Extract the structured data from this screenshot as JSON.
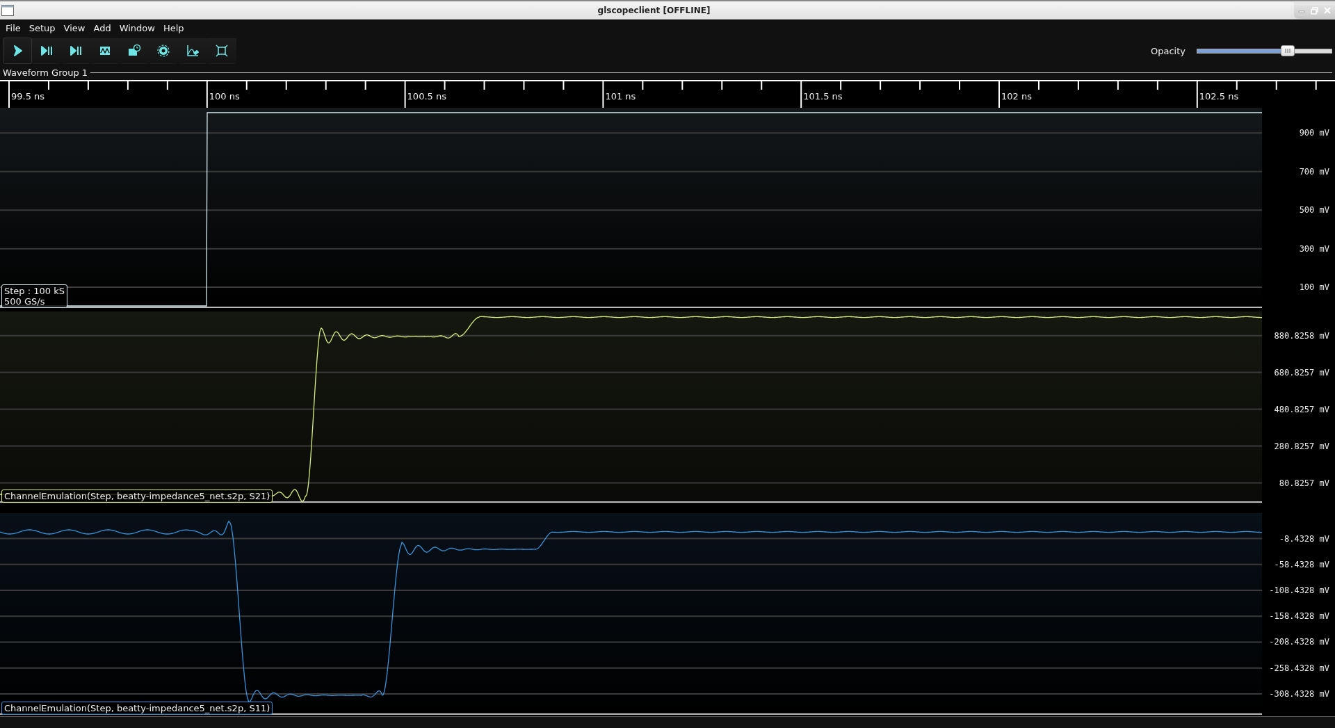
{
  "window": {
    "title": "glscopeclient [OFFLINE]"
  },
  "menu": [
    "File",
    "Setup",
    "View",
    "Add",
    "Window",
    "Help"
  ],
  "opacity": {
    "label": "Opacity",
    "level": 0.67
  },
  "group": {
    "title": "Waveform Group 1"
  },
  "timeline": {
    "labels": [
      "99.5 ns",
      "100 ns",
      "100.5 ns",
      "101 ns",
      "101.5 ns",
      "102 ns",
      "102.5 ns"
    ]
  },
  "panels": [
    {
      "kind": "step",
      "color": "#d4ecf2",
      "label": [
        "Step : 100 kS",
        "500 GS/s"
      ],
      "axis": [
        "900 mV",
        "700 mV",
        "500 mV",
        "300 mV",
        "100 mV"
      ]
    },
    {
      "kind": "through",
      "color": "#d6ef80",
      "label": [
        "ChannelEmulation(Step, beatty-impedance5_net.s2p, S21)"
      ],
      "axis": [
        "880.8258 mV",
        "680.8257 mV",
        "480.8257 mV",
        "280.8257 mV",
        "80.8257 mV"
      ]
    },
    {
      "kind": "reflect",
      "color": "#3a94dc",
      "label": [
        "ChannelEmulation(Step, beatty-impedance5_net.s2p, S11)"
      ],
      "axis": [
        "-8.4328 mV",
        "-58.4328 mV",
        "-108.4328 mV",
        "-158.4328 mV",
        "-208.4328 mV",
        "-258.4328 mV",
        "-308.4328 mV"
      ]
    }
  ]
}
